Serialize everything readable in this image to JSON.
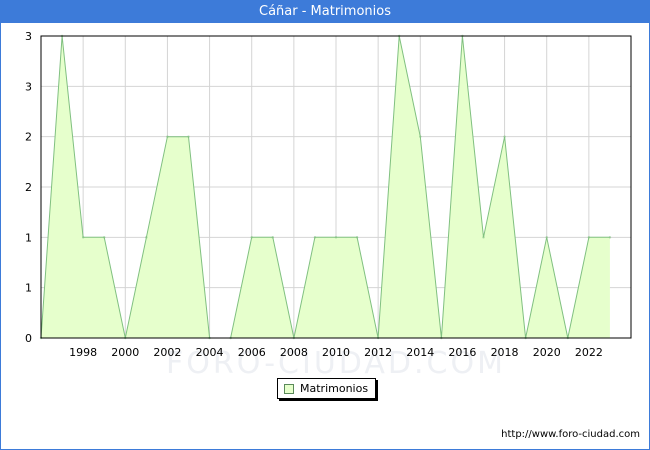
{
  "header": {
    "title": "Cáñar - Matrimonios"
  },
  "footer": {
    "source": "http://www.foro-ciudad.com"
  },
  "watermark": "FORO-CIUDAD.COM",
  "chart_data": {
    "type": "area",
    "title": "Cáñar - Matrimonios",
    "xlabel": "",
    "ylabel": "",
    "x": [
      1996,
      1997,
      1998,
      1999,
      2000,
      2001,
      2002,
      2003,
      2004,
      2005,
      2006,
      2007,
      2008,
      2009,
      2010,
      2011,
      2012,
      2013,
      2014,
      2015,
      2016,
      2017,
      2018,
      2019,
      2020,
      2021,
      2022,
      2023
    ],
    "series": [
      {
        "name": "Matrimonios",
        "values": [
          0,
          3,
          1,
          1,
          0,
          1,
          2,
          2,
          0,
          0,
          1,
          1,
          0,
          1,
          1,
          1,
          0,
          3,
          2,
          0,
          3,
          1,
          2,
          0,
          1,
          0,
          1,
          1
        ]
      }
    ],
    "xticks": [
      1998,
      2000,
      2002,
      2004,
      2006,
      2008,
      2010,
      2012,
      2014,
      2016,
      2018,
      2020,
      2022
    ],
    "ytick_labels": [
      "0",
      "1",
      "1",
      "2",
      "2",
      "3",
      "3"
    ],
    "ylim": [
      0,
      3
    ],
    "grid": true,
    "legend_position": "bottom-center",
    "colors": {
      "fill": "#e6ffcc",
      "line": "#80c080",
      "header": "#3d7bd9"
    }
  }
}
